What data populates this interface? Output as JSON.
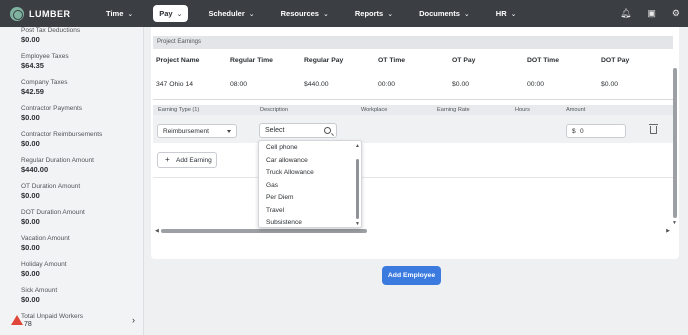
{
  "app": {
    "name": "LUMBER"
  },
  "nav": {
    "items": [
      {
        "label": "Time",
        "active": false
      },
      {
        "label": "Pay",
        "active": true
      },
      {
        "label": "Scheduler",
        "active": false
      },
      {
        "label": "Resources",
        "active": false
      },
      {
        "label": "Reports",
        "active": false
      },
      {
        "label": "Documents",
        "active": false
      },
      {
        "label": "HR",
        "active": false
      }
    ],
    "icons": [
      "bell-icon",
      "archive-icon",
      "gear-icon"
    ]
  },
  "sidebar": {
    "stats": [
      {
        "label": "Post Tax Deductions",
        "value": "$0.00"
      },
      {
        "label": "Employee Taxes",
        "value": "$64.35"
      },
      {
        "label": "Company Taxes",
        "value": "$42.59"
      },
      {
        "label": "Contractor Payments",
        "value": "$0.00"
      },
      {
        "label": "Contractor Reimbursements",
        "value": "$0.00"
      },
      {
        "label": "Regular Duration Amount",
        "value": "$440.00"
      },
      {
        "label": "OT Duration Amount",
        "value": "$0.00"
      },
      {
        "label": "DOT Duration Amount",
        "value": "$0.00"
      },
      {
        "label": "Vacation Amount",
        "value": "$0.00"
      },
      {
        "label": "Holiday Amount",
        "value": "$0.00"
      },
      {
        "label": "Sick Amount",
        "value": "$0.00"
      }
    ],
    "unpaid": {
      "label": "Total Unpaid Workers",
      "value": "78"
    }
  },
  "project_earnings": {
    "title": "Project Earnings",
    "columns": [
      "Project Name",
      "Regular Time",
      "Regular Pay",
      "OT Time",
      "OT Pay",
      "DOT Time",
      "DOT Pay"
    ],
    "rows": [
      [
        "347 Ohio 14",
        "08:00",
        "$440.00",
        "00:00",
        "$0.00",
        "00:00",
        "$0.00"
      ]
    ]
  },
  "earnings": {
    "columns": [
      "Earning Type (1)",
      "Description",
      "Workplace",
      "Earning Rate",
      "Hours",
      "Amount"
    ],
    "earning_type": "Reimbursement",
    "description_placeholder": "Select",
    "amount_currency": "$",
    "amount_value": "0",
    "add_label": "Add Earning"
  },
  "description_options": [
    "Cell phone",
    "Car allowance",
    "Truck Allowance",
    "Gas",
    "Per Diem",
    "Travel",
    "Subsistence"
  ],
  "add_employee_label": "Add Employee"
}
